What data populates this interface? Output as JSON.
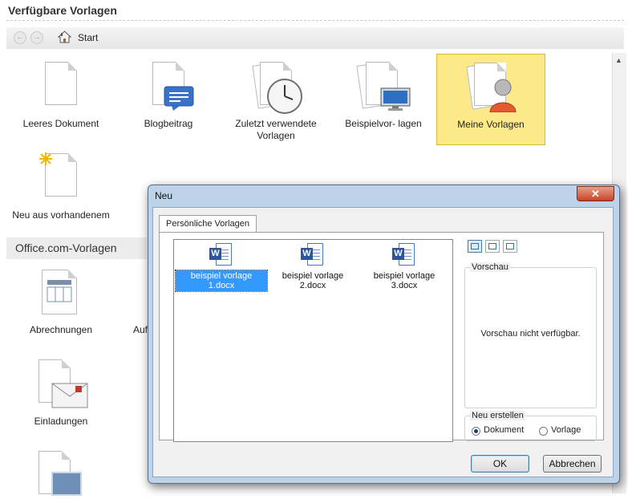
{
  "header": {
    "title": "Verfügbare Vorlagen"
  },
  "nav": {
    "back": "←",
    "forward": "→",
    "crumb": "Start"
  },
  "templates": [
    {
      "label": "Leeres Dokument"
    },
    {
      "label": "Blogbeitrag"
    },
    {
      "label_line1": "Zuletzt verwendete",
      "label_line2": "Vorlagen"
    },
    {
      "label": "Beispielvor- lagen"
    },
    {
      "label": "Meine Vorlagen",
      "selected": true
    },
    {
      "label": "Neu aus vorhandenem"
    }
  ],
  "office_section": {
    "title": "Office.com-Vorlagen",
    "items": [
      {
        "label": "Abrechnungen"
      },
      {
        "label": "Auf"
      },
      {
        "label": "Einladungen"
      }
    ]
  },
  "dialog": {
    "title": "Neu",
    "close": "✕",
    "tab": "Persönliche Vorlagen",
    "files": [
      {
        "name": "beispiel vorlage 1.docx",
        "selected": true
      },
      {
        "name": "beispiel vorlage 2.docx"
      },
      {
        "name": "beispiel vorlage 3.docx"
      }
    ],
    "word_badge": "W",
    "preview_label": "Vorschau",
    "preview_text": "Vorschau nicht verfügbar.",
    "create_label": "Neu erstellen",
    "create_options": [
      {
        "label": "Dokument",
        "checked": true
      },
      {
        "label": "Vorlage",
        "checked": false
      }
    ],
    "ok": "OK",
    "cancel": "Abbrechen"
  },
  "colors": {
    "selection": "#3399ff",
    "tile_selected": "#fce98a",
    "word_blue": "#2b579a"
  }
}
